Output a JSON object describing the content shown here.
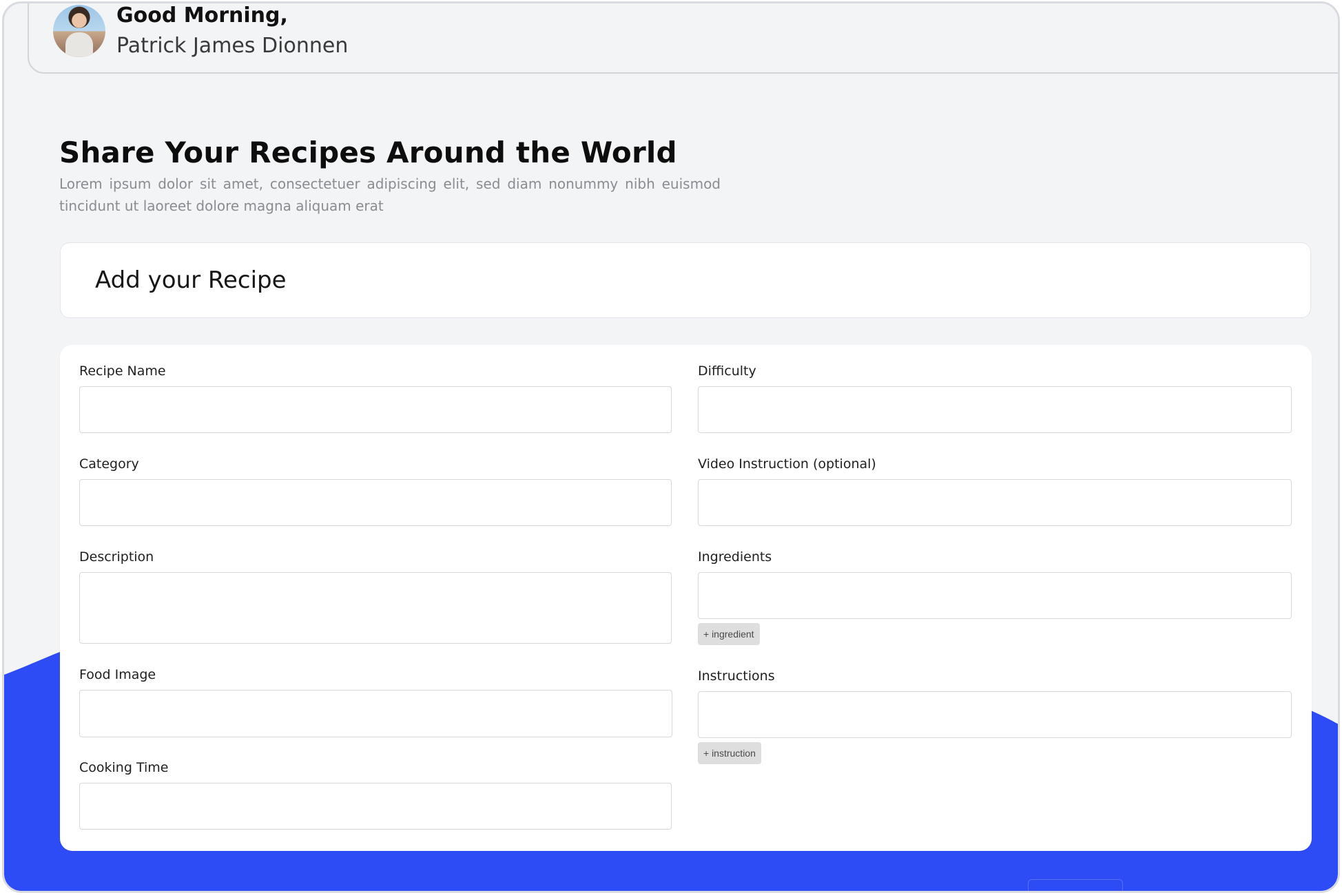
{
  "header": {
    "greeting": "Good Morning,",
    "user_name": "Patrick James Dionnen"
  },
  "hero": {
    "title": "Share Your Recipes Around the World",
    "description": "Lorem ipsum dolor sit amet, consectetuer adipiscing elit, sed diam nonummy nibh euismod tincidunt ut laoreet dolore magna aliquam erat"
  },
  "form_header": {
    "title": "Add your Recipe"
  },
  "form": {
    "recipe_name_label": "Recipe Name",
    "recipe_name_value": "",
    "category_label": "Category",
    "category_value": "",
    "description_label": "Description",
    "description_value": "",
    "food_image_label": "Food Image",
    "food_image_value": "",
    "cooking_time_label": "Cooking Time",
    "cooking_time_value": "",
    "difficulty_label": "Difficulty",
    "difficulty_value": "",
    "video_instruction_label": "Video Instruction (optional)",
    "video_instruction_value": "",
    "ingredients_label": "Ingredients",
    "ingredients_value": "",
    "add_ingredient_label": "+ ingredient",
    "instructions_label": "Instructions",
    "instructions_value": "",
    "add_instruction_label": "+ instruction"
  },
  "colors": {
    "accent": "#2d4cf5",
    "background": "#f3f4f6",
    "card": "#ffffff"
  }
}
